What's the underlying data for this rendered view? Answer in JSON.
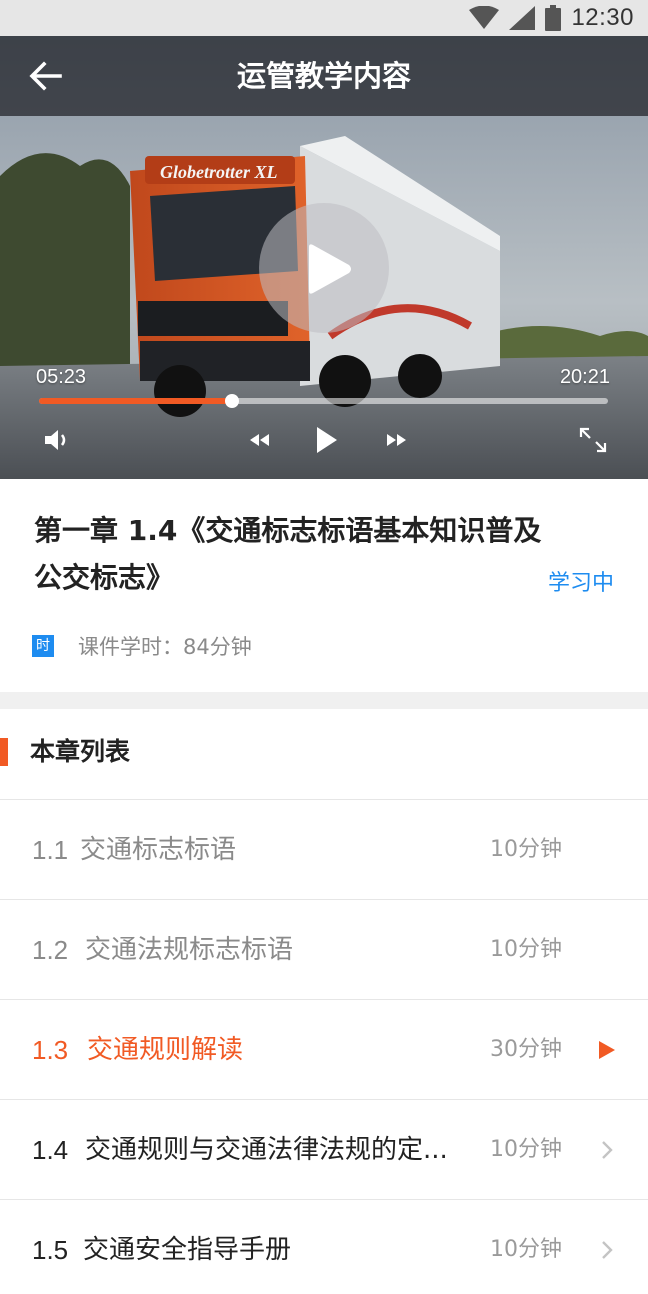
{
  "status_bar": {
    "time": "12:30",
    "icons": [
      "wifi-icon",
      "signal-icon",
      "battery-icon"
    ]
  },
  "header": {
    "title": "运管教学内容",
    "back_icon": "arrow-left-icon"
  },
  "video": {
    "current_time": "05:23",
    "total_time": "20:21",
    "progress": 0.34,
    "controls": [
      "volume-icon",
      "rewind-icon",
      "play-icon",
      "fast-forward-icon",
      "fullscreen-icon"
    ],
    "truck_text": "Globetrotter XL"
  },
  "lesson": {
    "title_line1": "第一章  1.4《交通标志标语基本知识普及",
    "title_line2": "公交标志》",
    "status": "学习中",
    "hours_badge": "时",
    "hours_label": "课件学时：",
    "hours_value": "84分钟"
  },
  "chapter_list": {
    "heading": "本章列表",
    "items": [
      {
        "num": "1.1",
        "title": "交通标志标语",
        "duration": "10分钟",
        "state": "done"
      },
      {
        "num": "1.2",
        "title": "交通法规标志标语",
        "duration": "10分钟",
        "state": "done"
      },
      {
        "num": "1.3",
        "title": "交通规则解读",
        "duration": "30分钟",
        "state": "playing"
      },
      {
        "num": "1.4",
        "title": "交通规则与交通法律法规的定...",
        "duration": "10分钟",
        "state": "pending"
      },
      {
        "num": "1.5",
        "title": "交通安全指导手册",
        "duration": "10分钟",
        "state": "pending"
      }
    ]
  },
  "colors": {
    "accent": "#f15a24",
    "blue": "#1e8cf0",
    "done_text": "#8a8a8a",
    "pending_text": "#222222"
  }
}
